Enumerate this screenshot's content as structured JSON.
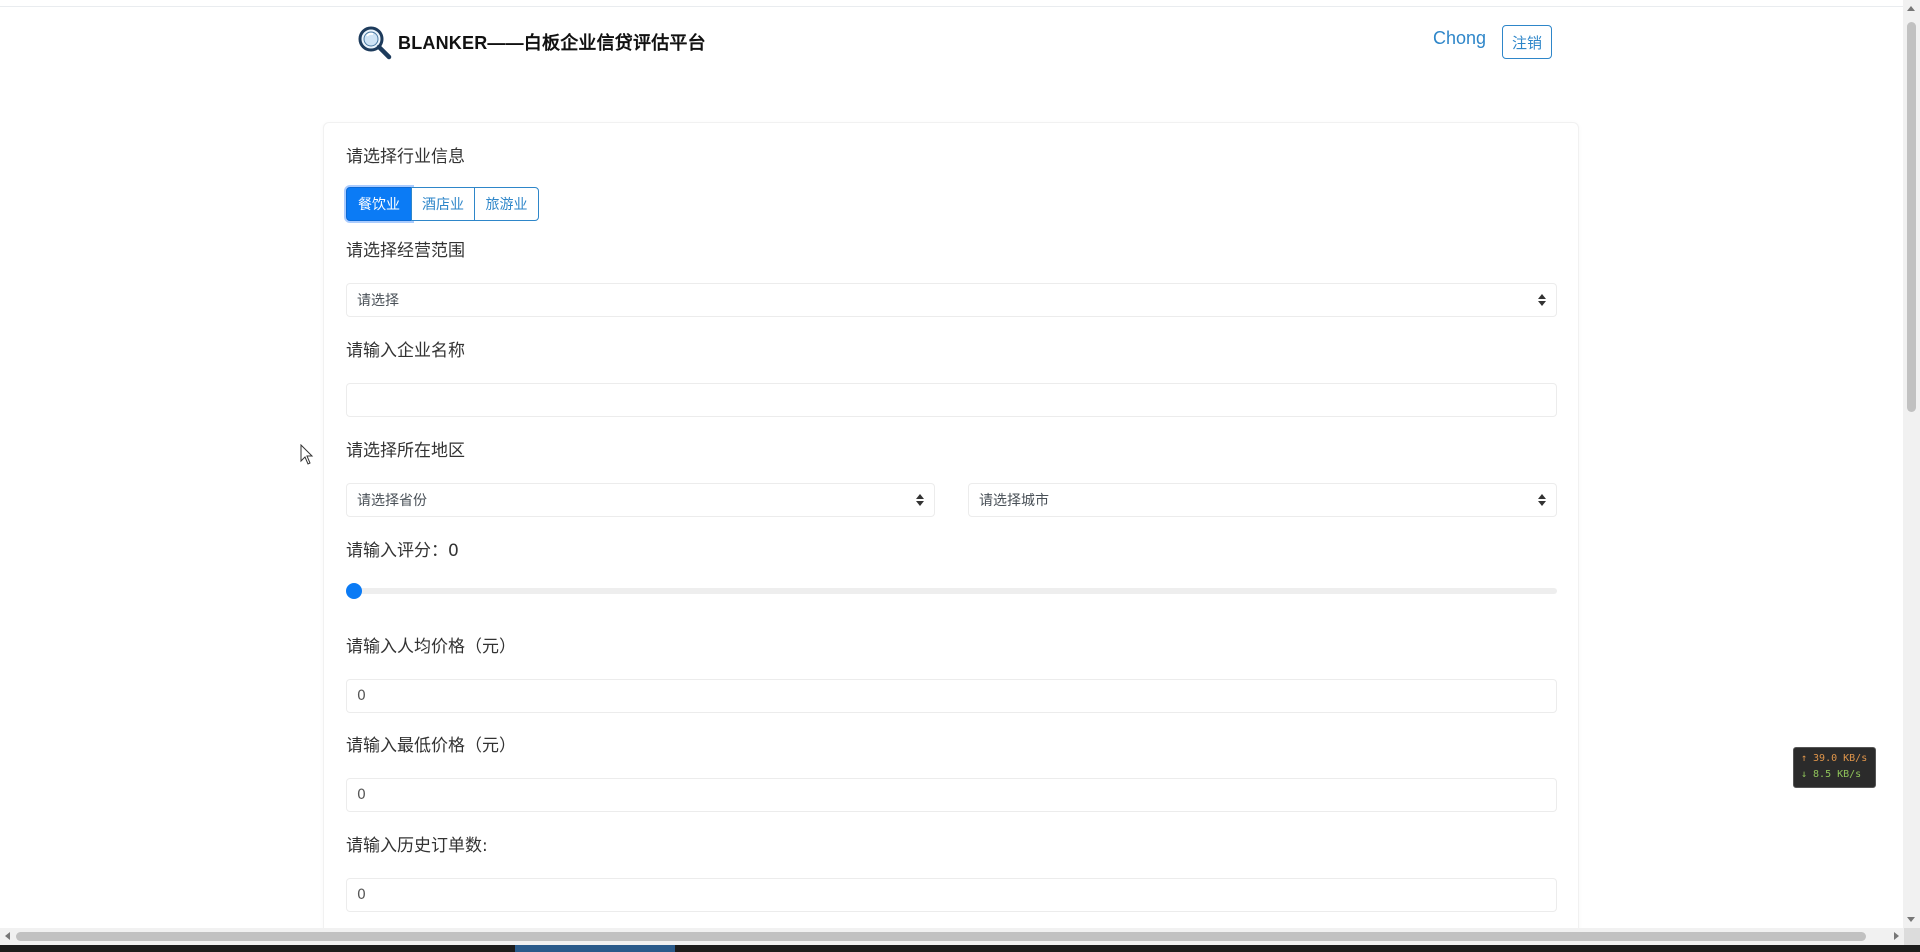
{
  "header": {
    "brand": "BLANKER——白板企业信贷评估平台",
    "user": "Chong",
    "logout_label": "注销"
  },
  "form": {
    "industry": {
      "label": "请选择行业信息",
      "options": [
        "餐饮业",
        "酒店业",
        "旅游业"
      ],
      "selected": "餐饮业"
    },
    "scope": {
      "label": "请选择经营范围",
      "value": "请选择"
    },
    "company": {
      "label": "请输入企业名称",
      "value": ""
    },
    "region": {
      "label": "请选择所在地区",
      "province": "请选择省份",
      "city": "请选择城市"
    },
    "rating": {
      "label": "请输入评分：0",
      "value": 0
    },
    "avg_price": {
      "label": "请输入人均价格（元）",
      "value": "0"
    },
    "min_price": {
      "label": "请输入最低价格（元）",
      "value": "0"
    },
    "orders": {
      "label": "请输入历史订单数:",
      "value": "0"
    }
  },
  "net_monitor": {
    "upload": "↑ 39.0 KB/s",
    "download": "↓ 8.5 KB/s"
  },
  "colors": {
    "primary": "#0b7bf5",
    "link": "#2e86c9"
  }
}
